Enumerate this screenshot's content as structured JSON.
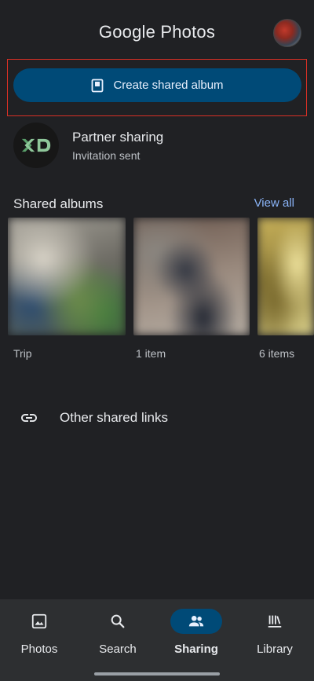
{
  "header": {
    "logo_brand": "Google",
    "logo_product": "Photos",
    "avatar_icon": "user-avatar"
  },
  "create_button": {
    "label": "Create shared album",
    "icon": "shared-album-icon",
    "color": "#004a77"
  },
  "partner": {
    "title": "Partner sharing",
    "status": "Invitation sent",
    "logo_icon": "xd-logo"
  },
  "shared_albums": {
    "title": "Shared albums",
    "view_all_label": "View all",
    "albums": [
      {
        "label": "Trip",
        "thumbnail": "blurred-photo"
      },
      {
        "label": "1 item",
        "thumbnail": "blurred-photo"
      },
      {
        "label": "6 items",
        "thumbnail": "blurred-photo"
      }
    ]
  },
  "other_links": {
    "label": "Other shared links",
    "icon": "link-icon"
  },
  "bottom_nav": {
    "items": [
      {
        "label": "Photos",
        "icon": "photo-icon",
        "active": false
      },
      {
        "label": "Search",
        "icon": "search-icon",
        "active": false
      },
      {
        "label": "Sharing",
        "icon": "people-icon",
        "active": true
      },
      {
        "label": "Library",
        "icon": "library-icon",
        "active": false
      }
    ]
  },
  "colors": {
    "background": "#202124",
    "accent": "#8ab4f8",
    "active_pill": "#004a77",
    "highlight_border": "#d93025"
  }
}
